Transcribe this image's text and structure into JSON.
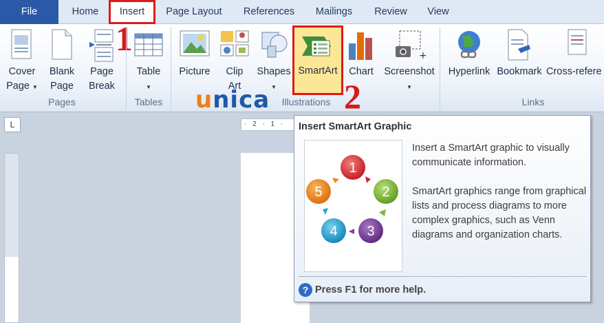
{
  "tabs": {
    "file": "File",
    "home": "Home",
    "insert": "Insert",
    "page_layout": "Page Layout",
    "references": "References",
    "mailings": "Mailings",
    "review": "Review",
    "view": "View"
  },
  "ribbon": {
    "cover_page": [
      "Cover",
      "Page"
    ],
    "blank_page": [
      "Blank",
      "Page"
    ],
    "page_break": [
      "Page",
      "Break"
    ],
    "table": "Table",
    "picture": "Picture",
    "clip_art": [
      "Clip",
      "Art"
    ],
    "shapes": "Shapes",
    "smartart": "SmartArt",
    "chart": "Chart",
    "screenshot": "Screenshot",
    "hyperlink": "Hyperlink",
    "bookmark": "Bookmark",
    "cross_reference": "Cross-refere",
    "groups": {
      "pages": "Pages",
      "tables": "Tables",
      "illustrations": "Illustrations",
      "links": "Links"
    }
  },
  "annotations": {
    "marker1": "1",
    "marker2": "2",
    "watermark_u1": "u",
    "watermark_rest": "nica"
  },
  "rulers": {
    "corner": "L",
    "horizontal": "· 2 · 1 ·"
  },
  "tooltip": {
    "title": "Insert SmartArt Graphic",
    "para1": "Insert a SmartArt graphic to visually communicate information.",
    "para2": "SmartArt graphics range from graphical lists and process diagrams to more complex graphics, such as Venn diagrams and organization charts.",
    "help": "Press F1 for more help.",
    "help_icon": "?",
    "diagram_numbers": [
      "1",
      "2",
      "3",
      "4",
      "5"
    ]
  },
  "colors": {
    "file_tab": "#2a5aa7",
    "highlight_border": "#e0191b",
    "smartart_highlight": "#fbe795",
    "circle1": "#d9262c",
    "circle2": "#7cbb2e",
    "circle3": "#7a3f98",
    "circle4": "#25a6d8",
    "circle5": "#f08a1c"
  }
}
